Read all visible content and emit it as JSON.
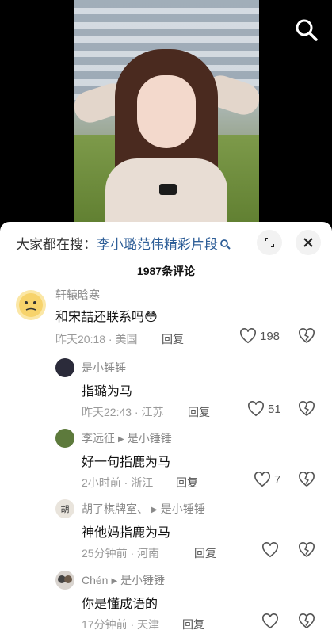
{
  "video": {
    "search_icon": "search-icon"
  },
  "panel": {
    "search_prefix": "大家都在搜：",
    "search_keyword": "李小璐范伟精彩片段",
    "comment_count": "1987条评论"
  },
  "comments": [
    {
      "user": "轩辕晗寒",
      "text": "和宋喆还联系吗",
      "emoji": "😳",
      "time": "昨天20:18",
      "location": "美国",
      "reply": "回复",
      "likes": "198"
    },
    {
      "user": "是小锤锤",
      "text": "指璐为马",
      "time": "昨天22:43",
      "location": "江苏",
      "reply": "回复",
      "likes": "51"
    },
    {
      "user": "李远征",
      "reply_to": "是小锤锤",
      "text": "好一句指鹿为马",
      "time": "2小时前",
      "location": "浙江",
      "reply": "回复",
      "likes": "7"
    },
    {
      "user": "胡了棋牌室、",
      "reply_to": "是小锤锤",
      "text": "神他妈指鹿为马",
      "time": "25分钟前",
      "location": "河南",
      "reply": "回复",
      "likes": ""
    },
    {
      "user": "Chén",
      "reply_to": "是小锤锤",
      "text": "你是懂成语的",
      "time": "17分钟前",
      "location": "天津",
      "reply": "回复",
      "likes": ""
    }
  ]
}
